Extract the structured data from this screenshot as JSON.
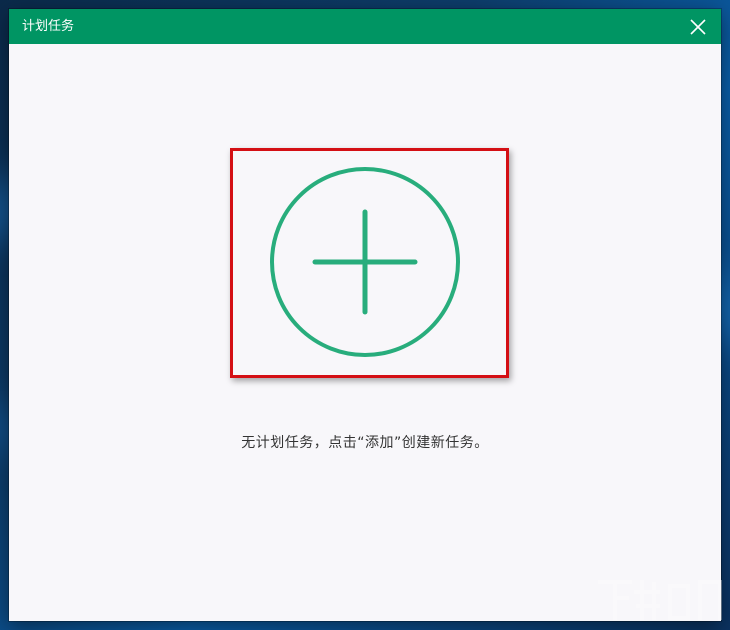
{
  "window": {
    "title": "计划任务",
    "close_icon": "close-icon"
  },
  "main": {
    "add_icon": "plus-circle-icon",
    "hint_text": "无计划任务，点击“添加”创建新任务。"
  },
  "colors": {
    "titlebar": "#009563",
    "accent": "#28ad7c",
    "highlight_border": "#d40f14",
    "panel_bg": "#f8f7fa"
  }
}
